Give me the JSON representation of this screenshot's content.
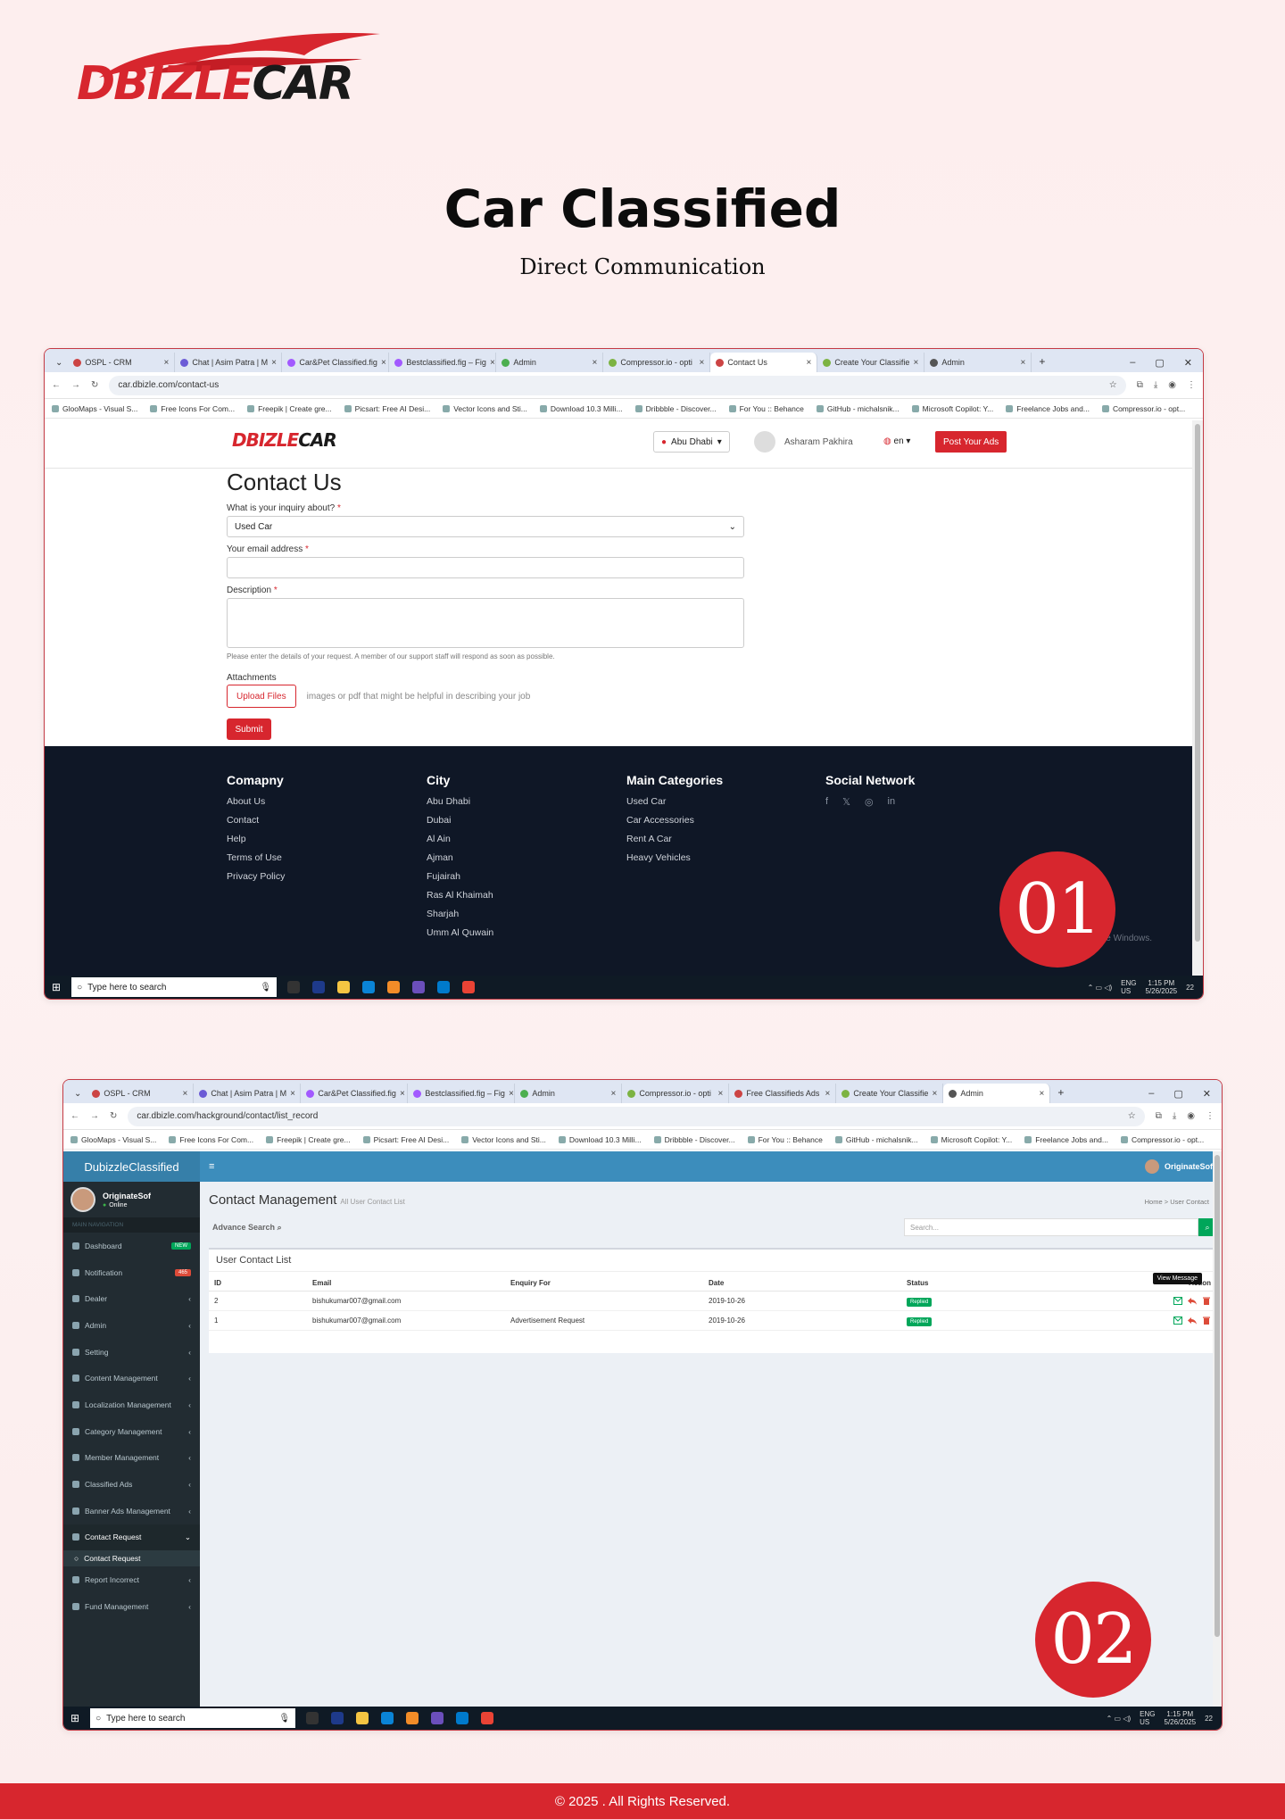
{
  "brand": {
    "logo_part1": "DBIZLE",
    "logo_part2": "CAR",
    "accent": "#d7262e"
  },
  "hero": {
    "title": "Car Classified",
    "subtitle": "Direct Communication"
  },
  "shot1": {
    "tabs": [
      "OSPL - CRM",
      "Chat | Asim Patra | M",
      "Car&Pet Classified.fig",
      "Bestclassified.fig – Fig",
      "Admin",
      "Compressor.io - opti",
      "Contact Us",
      "Create Your Classifie",
      "Admin"
    ],
    "url": "car.dbizle.com/contact-us",
    "bookmarks": [
      "GlooMaps - Visual S...",
      "Free Icons For Com...",
      "Freepik | Create gre...",
      "Picsart: Free AI Desi...",
      "Vector Icons and Sti...",
      "Download 10.3 Milli...",
      "Dribbble - Discover...",
      "For You :: Behance",
      "GitHub - michalsnik...",
      "Microsoft Copilot: Y...",
      "Freelance Jobs and...",
      "Compressor.io - opt..."
    ],
    "site": {
      "location": "Abu Dhabi",
      "user_name": "Asharam Pakhira",
      "lang": "en",
      "post_button": "Post Your Ads"
    },
    "form": {
      "title": "Contact Us",
      "inquiry_label": "What is your inquiry about?",
      "inquiry_value": "Used Car",
      "email_label": "Your email address",
      "description_label": "Description",
      "hint": "Please enter the details of your request. A member of our support staff will respond as soon as possible.",
      "attachments_label": "Attachments",
      "upload_button": "Upload Files",
      "upload_hint": "images or pdf that might be helpful in describing your job",
      "submit": "Submit"
    },
    "footer": {
      "company": {
        "title": "Comapny",
        "items": [
          "About Us",
          "Contact",
          "Help",
          "Terms of Use",
          "Privacy Policy"
        ]
      },
      "city": {
        "title": "City",
        "items": [
          "Abu Dhabi",
          "Dubai",
          "Al Ain",
          "Ajman",
          "Fujairah",
          "Ras Al Khaimah",
          "Sharjah",
          "Umm Al Quwain"
        ]
      },
      "categories": {
        "title": "Main Categories",
        "items": [
          "Used Car",
          "Car Accessories",
          "Rent A Car",
          "Heavy Vehicles"
        ]
      },
      "social": {
        "title": "Social Network",
        "icons": [
          "f",
          "𝕏",
          "◎",
          "in"
        ]
      },
      "watermark": "te Windows."
    },
    "badge": "01"
  },
  "taskbar": {
    "search_placeholder": "Type here to search",
    "lang1": "ENG",
    "lang2": "US",
    "time": "1:15 PM",
    "date": "5/26/2025",
    "notif": "22"
  },
  "shot2": {
    "tabs": [
      "OSPL - CRM",
      "Chat | Asim Patra | M",
      "Car&Pet Classified.fig",
      "Bestclassified.fig – Fig",
      "Admin",
      "Compressor.io - opti",
      "Free Classifieds Ads",
      "Create Your Classifie",
      "Admin"
    ],
    "url": "car.dbizle.com/hackground/contact/list_record",
    "admin": {
      "brand": "DubizzleClassified",
      "user": "OriginateSof",
      "status": "Online",
      "nav_header": "MAIN NAVIGATION",
      "menu": [
        {
          "label": "Dashboard",
          "badge": "NEW",
          "badge_color": "#00a65a"
        },
        {
          "label": "Notification",
          "badge": "465",
          "badge_color": "#dd4b39"
        },
        {
          "label": "Dealer"
        },
        {
          "label": "Admin"
        },
        {
          "label": "Setting"
        },
        {
          "label": "Content Management"
        },
        {
          "label": "Localization Management"
        },
        {
          "label": "Category Management"
        },
        {
          "label": "Member Management"
        },
        {
          "label": "Classified Ads"
        },
        {
          "label": "Banner Ads Management"
        },
        {
          "label": "Contact Request"
        }
      ],
      "submenu": "Contact Request",
      "menu_after": [
        {
          "label": "Report Incorrect"
        },
        {
          "label": "Fund Management"
        }
      ],
      "page_title": "Contact Management",
      "page_subtitle": "All User Contact List",
      "crumb_home": "Home",
      "crumb_current": "User Contact",
      "advance_search": "Advance Search",
      "search_placeholder": "Search...",
      "panel_title": "User Contact List",
      "columns": [
        "ID",
        "Email",
        "Enquiry For",
        "Date",
        "Status",
        "Action"
      ],
      "rows": [
        {
          "id": "2",
          "email": "bishukumar007@gmail.com",
          "enquiry": "",
          "date": "2019-10-26",
          "status": "Replied"
        },
        {
          "id": "1",
          "email": "bishukumar007@gmail.com",
          "enquiry": "Advertisement Request",
          "date": "2019-10-26",
          "status": "Replied"
        }
      ],
      "tooltip": "View Message"
    },
    "badge": "02"
  },
  "copyright": "© 2025 . All Rights Reserved."
}
